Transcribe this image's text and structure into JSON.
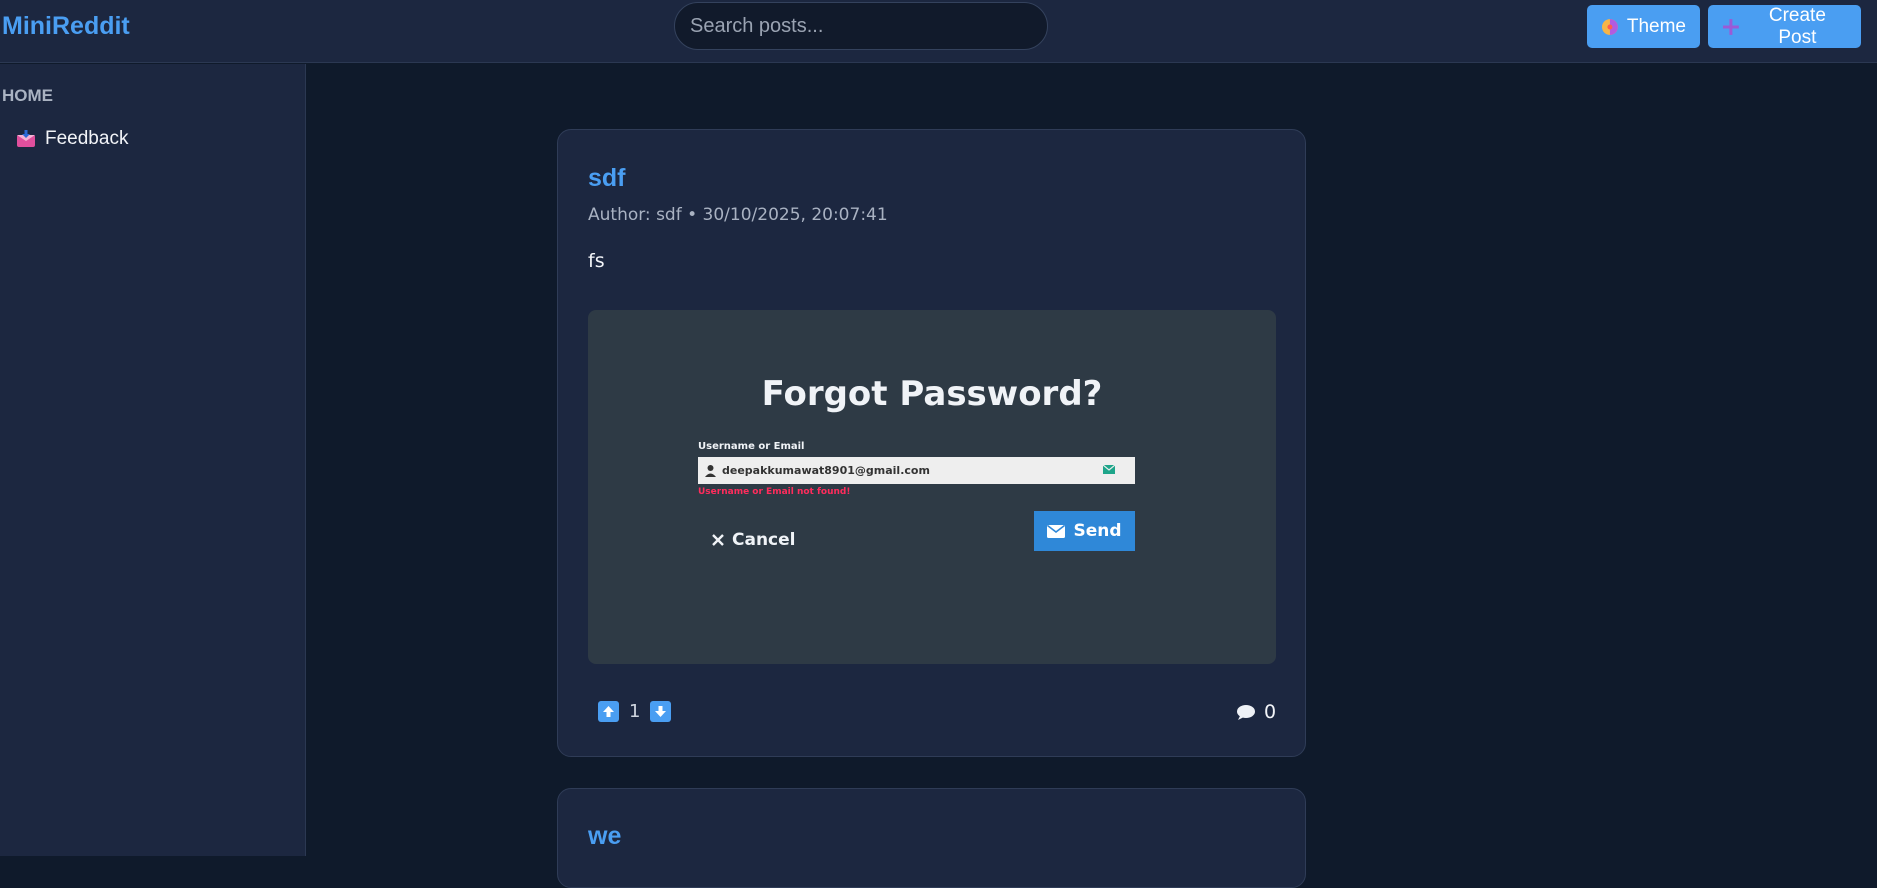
{
  "app": {
    "name": "MiniReddit"
  },
  "header": {
    "search_placeholder": "Search posts...",
    "theme_label": "Theme",
    "create_label": "Create Post"
  },
  "sidebar": {
    "heading": "HOME",
    "items": [
      {
        "label": "Feedback",
        "icon": "inbox-tray-icon"
      }
    ]
  },
  "posts": [
    {
      "title": "sdf",
      "meta": "Author: sdf • 30/10/2025, 20:07:41",
      "body": "fs",
      "image": {
        "heading": "Forgot Password?",
        "field_label": "Username or Email",
        "field_value": "deepakkumawat8901@gmail.com",
        "error": "Username or Email not found!",
        "cancel_label": "Cancel",
        "send_label": "Send"
      },
      "votes": "1",
      "comments": "0"
    },
    {
      "title": "we"
    }
  ],
  "colors": {
    "accent": "#4a9ef2",
    "background": "#0f1a2b",
    "panel": "#1c2740",
    "error": "#ff2c5c"
  }
}
